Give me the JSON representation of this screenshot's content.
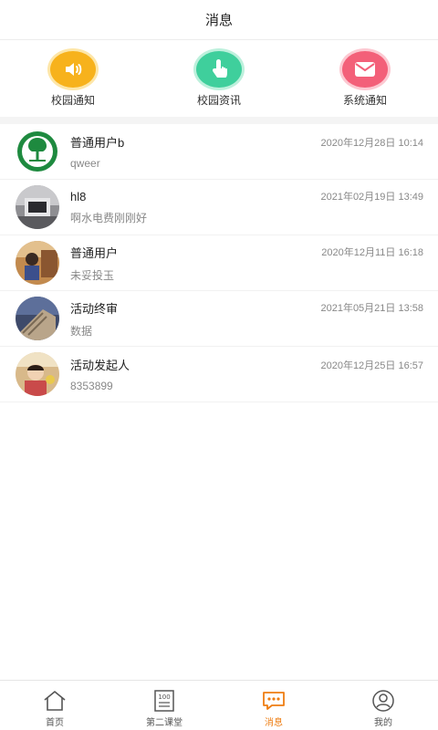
{
  "header": {
    "title": "消息"
  },
  "quick_links": [
    {
      "label": "校园通知",
      "icon": "speaker-icon",
      "color": "#f7b21c"
    },
    {
      "label": "校园资讯",
      "icon": "tap-finger-icon",
      "color": "#3fcf9c"
    },
    {
      "label": "系统通知",
      "icon": "envelope-icon",
      "color": "#f36079"
    }
  ],
  "messages": [
    {
      "name": "普通用户b",
      "time": "2020年12月28日 10:14",
      "preview": "qweer"
    },
    {
      "name": "hl8",
      "time": "2021年02月19日 13:49",
      "preview": "啊水电费刚刚好"
    },
    {
      "name": "普通用户",
      "time": "2020年12月11日 16:18",
      "preview": "未妥投玉"
    },
    {
      "name": "活动终审",
      "time": "2021年05月21日 13:58",
      "preview": "数据"
    },
    {
      "name": "活动发起人",
      "time": "2020年12月25日 16:57",
      "preview": "8353899"
    }
  ],
  "tabbar": {
    "items": [
      {
        "label": "首页",
        "icon": "home-icon"
      },
      {
        "label": "第二课堂",
        "icon": "score-board-icon"
      },
      {
        "label": "消息",
        "icon": "chat-icon",
        "active": true
      },
      {
        "label": "我的",
        "icon": "user-icon"
      }
    ],
    "active_color": "#ee7d12"
  }
}
